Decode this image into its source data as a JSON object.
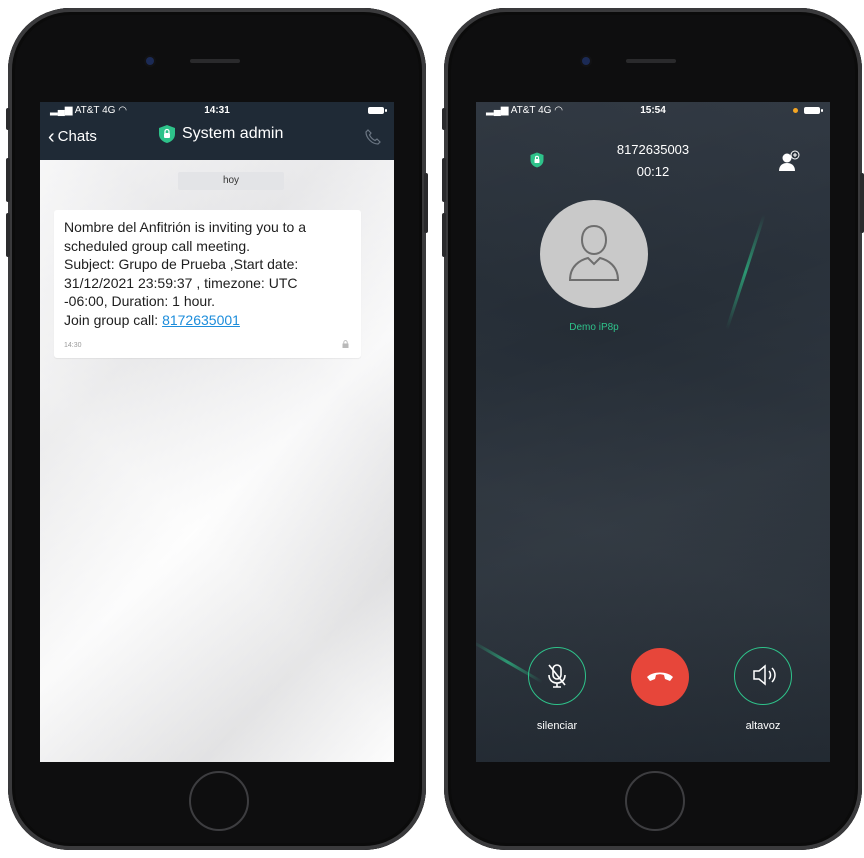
{
  "left_phone": {
    "status": {
      "carrier": "AT&T 4G",
      "time": "14:31"
    },
    "header": {
      "back_label": "Chats",
      "title": "System admin"
    },
    "chat": {
      "day_separator": "hoy",
      "message": {
        "lines": [
          "Nombre del Anfitrión is inviting you to a",
          "scheduled group call meeting.",
          "Subject: Grupo de Prueba ,Start date:",
          "31/12/2021 23:59:37 , timezone: UTC",
          "-06:00, Duration: 1 hour."
        ],
        "join_prefix": "Join group call: ",
        "join_number": "8172635001",
        "time": "14:30"
      }
    }
  },
  "right_phone": {
    "status": {
      "carrier": "AT&T 4G",
      "time": "15:54"
    },
    "call": {
      "number": "8172635003",
      "duration": "00:12",
      "contact_name": "Demo iP8p",
      "mute_label": "silenciar",
      "speaker_label": "altavoz"
    }
  },
  "colors": {
    "header_bg": "#1f2a36",
    "shield_green": "#2ec28a",
    "link": "#1d8ddb",
    "hangup_red": "#e7463a",
    "call_bg": "#272f38"
  },
  "icons": [
    "chevron-left-icon",
    "shield-lock-icon",
    "phone-call-icon",
    "lock-icon",
    "add-contact-icon",
    "user-silhouette-icon",
    "microphone-icon",
    "hangup-icon",
    "speaker-icon",
    "wifi-icon",
    "battery-icon"
  ]
}
